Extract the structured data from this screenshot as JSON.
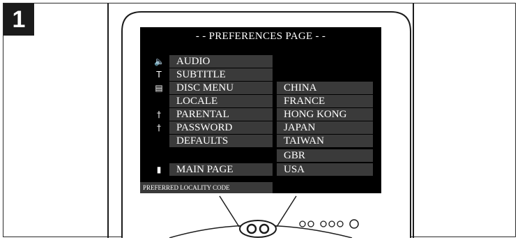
{
  "step": {
    "number": "1"
  },
  "screen": {
    "title": "- - PREFERENCES PAGE - -",
    "left_menu": [
      {
        "label": "AUDIO",
        "icon": "speaker-icon",
        "glyph": "🔈"
      },
      {
        "label": "SUBTITLE",
        "icon": "subtitle-icon",
        "glyph": "T"
      },
      {
        "label": "DISC MENU",
        "icon": "disc-menu-icon",
        "glyph": "▤"
      },
      {
        "label": "LOCALE",
        "icon": "",
        "glyph": ""
      },
      {
        "label": "PARENTAL",
        "icon": "key-icon",
        "glyph": "†"
      },
      {
        "label": "PASSWORD",
        "icon": "key-icon",
        "glyph": "†"
      },
      {
        "label": "DEFAULTS",
        "icon": "",
        "glyph": ""
      }
    ],
    "main_page": {
      "label": "MAIN PAGE",
      "icon": "door-icon",
      "glyph": "▮"
    },
    "locale_options": [
      "CHINA",
      "FRANCE",
      "HONG KONG",
      "JAPAN",
      "TAIWAN",
      "GBR",
      "USA"
    ],
    "status": "PREFERRED LOCALITY CODE"
  },
  "colors": {
    "screen_bg": "#000000",
    "item_bg": "#3a3a3a",
    "text": "#ffffff",
    "badge_bg": "#1b1b1b"
  }
}
